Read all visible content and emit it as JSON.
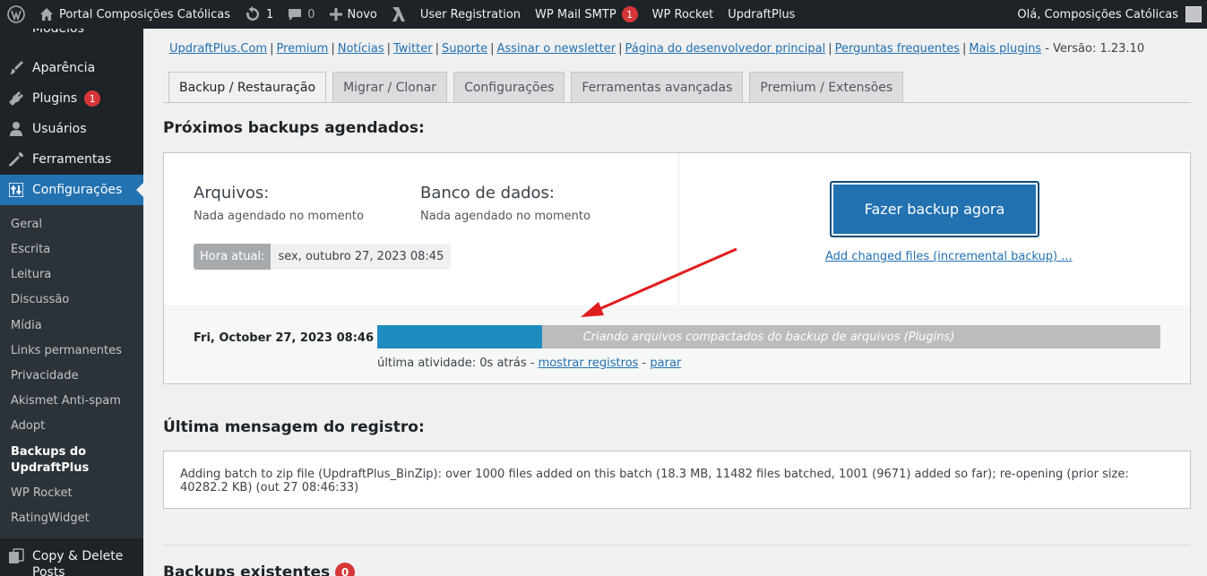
{
  "adminbar": {
    "site_name": "Portal Composições Católicas",
    "updates_count": "1",
    "comments_count": "0",
    "new_label": "Novo",
    "items": [
      "User Registration",
      "WP Mail SMTP",
      "WP Rocket",
      "UpdraftPlus"
    ],
    "smtp_badge": "1",
    "greeting": "Olá, Composições Católicas"
  },
  "sidebar": {
    "models_label": "Modelos",
    "appearance": "Aparência",
    "plugins": "Plugins",
    "plugins_badge": "1",
    "users": "Usuários",
    "tools": "Ferramentas",
    "settings": "Configurações",
    "sub": [
      "Geral",
      "Escrita",
      "Leitura",
      "Discussão",
      "Mídia",
      "Links permanentes",
      "Privacidade",
      "Akismet Anti-spam",
      "Adopt"
    ],
    "current_sub_line1": "Backups do",
    "current_sub_line2": "UpdraftPlus",
    "after": [
      "WP Rocket",
      "RatingWidget"
    ],
    "copy_delete_line1": "Copy & Delete",
    "copy_delete_line2": "Posts"
  },
  "links": {
    "items": [
      "UpdraftPlus.Com",
      "Premium",
      "Notícias",
      "Twitter",
      "Suporte",
      "Assinar o newsletter",
      "Página do desenvolvedor principal",
      "Perguntas frequentes",
      "Mais plugins"
    ],
    "version": " - Versão: 1.23.10"
  },
  "tabs": [
    "Backup / Restauração",
    "Migrar / Clonar",
    "Configurações",
    "Ferramentas avançadas",
    "Premium / Extensões"
  ],
  "scheduled": {
    "heading": "Próximos backups agendados:",
    "files_head": "Arquivos:",
    "files_text": "Nada agendado no momento",
    "db_head": "Banco de dados:",
    "db_text": "Nada agendado no momento",
    "time_label": "Hora atual:",
    "time_value": "sex, outubro 27, 2023 08:45",
    "backup_button": "Fazer backup agora",
    "incremental_link": "Add changed files (incremental backup) ..."
  },
  "progress": {
    "date": "Fri, October 27, 2023 08:46",
    "percent": 21,
    "status": "Criando arquivos compactados do backup de arquivos (Plugins)",
    "activity_prefix": "última atividade: 0s atrás - ",
    "show_logs": "mostrar registros",
    "dash": " - ",
    "stop": "parar"
  },
  "log": {
    "heading": "Última mensagem do registro:",
    "message": "Adding batch to zip file (UpdraftPlus_BinZip): over 1000 files added on this batch (18.3 MB, 11482 files batched, 1001 (9671) added so far); re-opening (prior size: 40282.2 KB) (out 27 08:46:33)"
  },
  "existing": {
    "heading": "Backups existentes",
    "count": "0"
  },
  "colors": {
    "accent": "#2271b1",
    "progress_fill": "#1e8cbe",
    "badge": "#d63638",
    "annotation_arrow": "#e01e1e"
  }
}
